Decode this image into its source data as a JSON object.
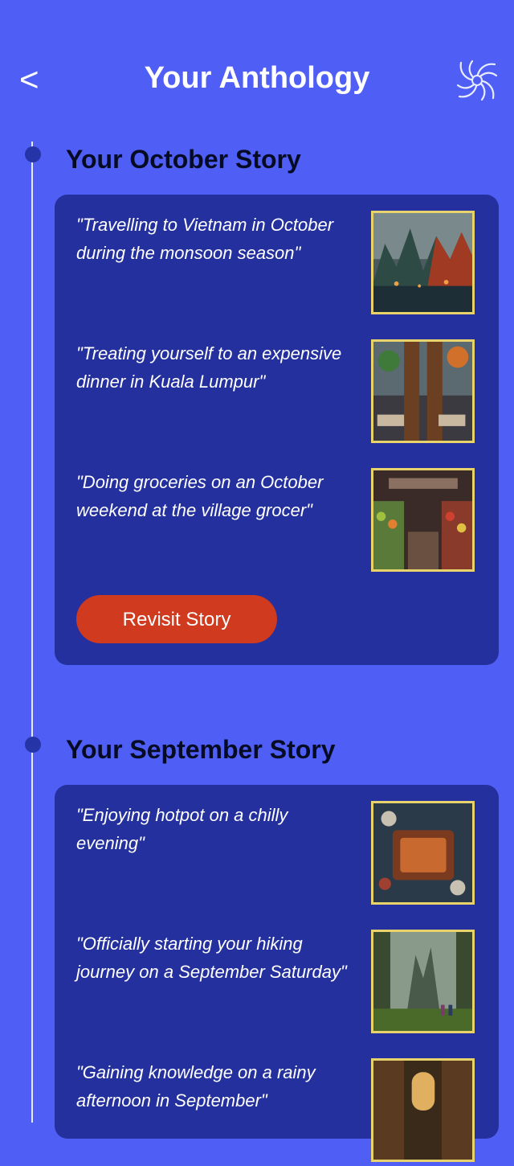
{
  "header": {
    "back_label": "<",
    "title": "Your Anthology",
    "logo_icon": "swirl-logo-icon"
  },
  "colors": {
    "background": "#4f5ef5",
    "card": "#24309d",
    "button": "#d03a1e",
    "thumb_border": "#e8d26b"
  },
  "stories": [
    {
      "title": "Your October Story",
      "items": [
        {
          "quote": "\"Travelling to Vietnam in October during the monsoon season\"",
          "image": "vietnam-mountains-image"
        },
        {
          "quote": "\"Treating yourself to an expensive dinner in Kuala Lumpur\"",
          "image": "restaurant-dinner-image"
        },
        {
          "quote": "\"Doing groceries on an October weekend at the village grocer\"",
          "image": "grocery-store-image"
        }
      ],
      "button_label": "Revisit Story"
    },
    {
      "title": "Your September Story",
      "items": [
        {
          "quote": "\"Enjoying hotpot on a chilly evening\"",
          "image": "hotpot-image"
        },
        {
          "quote": "\"Officially starting your hiking journey on a September Saturday\"",
          "image": "hiking-forest-image"
        },
        {
          "quote": "\"Gaining knowledge on a rainy afternoon in September\"",
          "image": "library-image"
        }
      ]
    }
  ]
}
